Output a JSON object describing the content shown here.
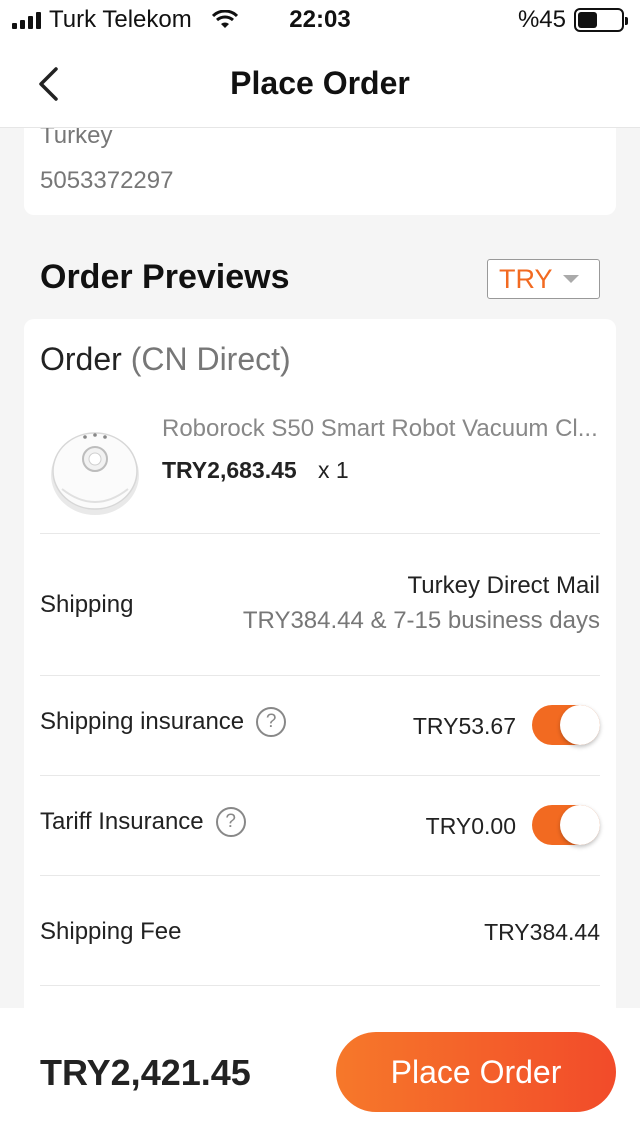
{
  "status_bar": {
    "carrier": "Turk Telekom",
    "time": "22:03",
    "battery_text": "%45",
    "battery_level_percent": 45
  },
  "nav": {
    "title": "Place Order",
    "back_icon": "chevron-left-icon"
  },
  "address": {
    "country": "Turkey",
    "phone": "5053372297"
  },
  "order_previews": {
    "title": "Order Previews",
    "currency": "TRY"
  },
  "order": {
    "title": "Order",
    "subtitle": "(CN Direct)",
    "product": {
      "name": "Roborock S50 Smart Robot Vacuum Cl...",
      "price": "TRY2,683.45",
      "quantity": "x 1",
      "image_icon": "robot-vacuum-image"
    },
    "shipping": {
      "label": "Shipping",
      "method": "Turkey Direct Mail",
      "detail": "TRY384.44 & 7-15 business days"
    },
    "shipping_insurance": {
      "label": "Shipping insurance",
      "value": "TRY53.67",
      "enabled": true
    },
    "tariff_insurance": {
      "label": "Tariff Insurance",
      "value": "TRY0.00",
      "enabled": true
    },
    "shipping_fee": {
      "label": "Shipping Fee",
      "value": "TRY384.44"
    }
  },
  "bottom": {
    "total": "TRY2,421.45",
    "place_order_label": "Place Order"
  },
  "colors": {
    "accent": "#f26a21",
    "button_gradient_start": "#f6782a",
    "button_gradient_end": "#f24b2a"
  },
  "icons": {
    "help": "?"
  }
}
